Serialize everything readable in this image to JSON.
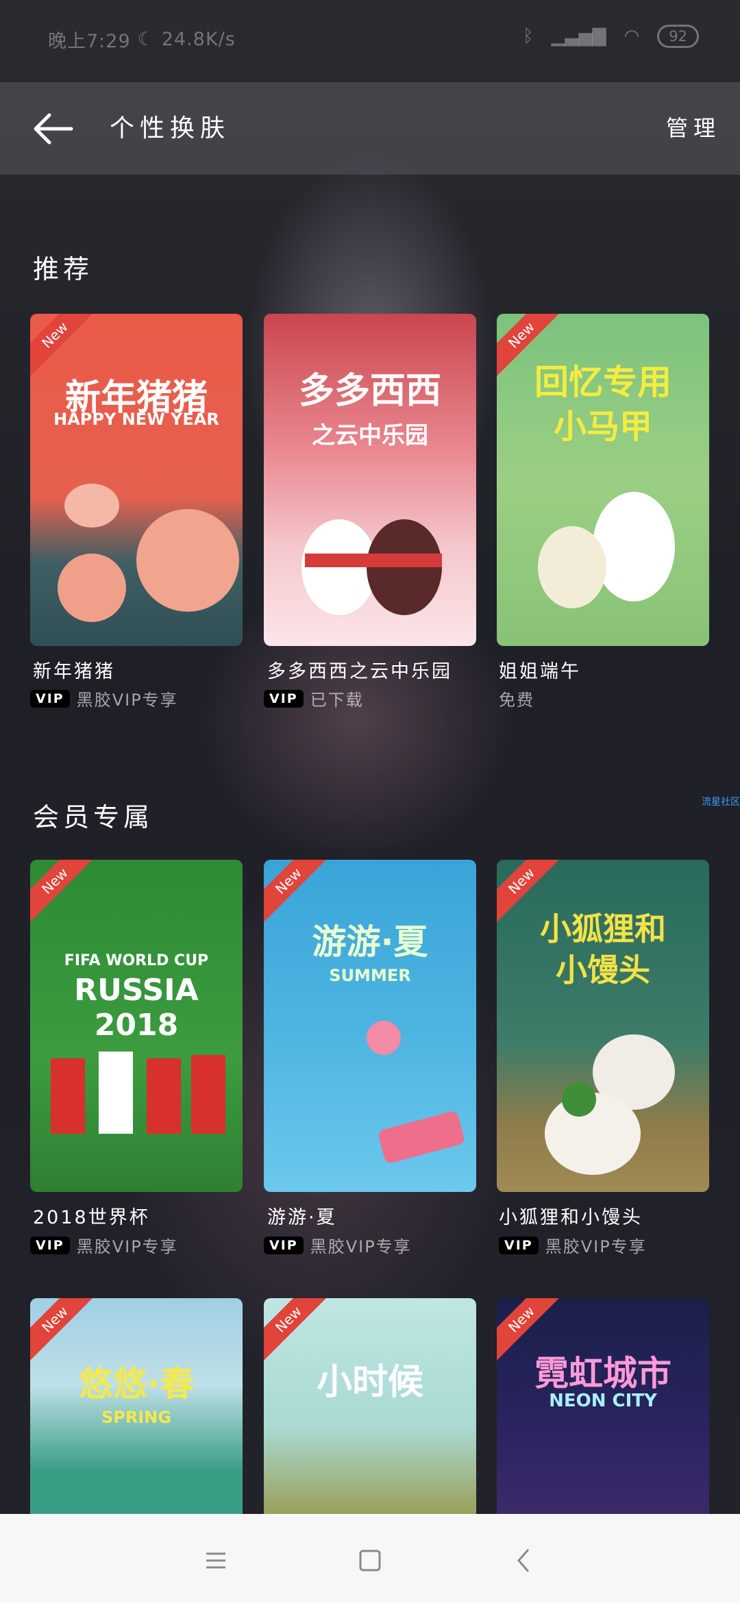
{
  "status_bar": {
    "time": "晚上7:29",
    "net_speed": "24.8K/s",
    "battery": "92"
  },
  "header": {
    "title": "个性换肤",
    "manage_label": "管理"
  },
  "sections": [
    {
      "title": "推荐"
    },
    {
      "title": "会员专属"
    }
  ],
  "recommended": [
    {
      "card_text": "新年猪猪",
      "card_sub": "HAPPY NEW YEAR",
      "name": "新年猪猪",
      "badge": "VIP",
      "status": "黑胶VIP专享",
      "ribbon": "New"
    },
    {
      "card_text": "多多西西",
      "card_sub": "之云中乐园",
      "name": "多多西西之云中乐园",
      "badge": "VIP",
      "status": "已下载",
      "ribbon": ""
    },
    {
      "card_text": "回忆专用",
      "card_sub": "小马甲",
      "name": "姐姐端午",
      "badge": "",
      "status": "免费",
      "ribbon": "New"
    }
  ],
  "vip": [
    {
      "card_text": "FIFA WORLD CUP",
      "card_sub": "RUSSIA 2018",
      "name": "2018世界杯",
      "badge": "VIP",
      "status": "黑胶VIP专享",
      "ribbon": "New"
    },
    {
      "card_text": "游游·夏",
      "card_sub": "SUMMER",
      "name": "游游·夏",
      "badge": "VIP",
      "status": "黑胶VIP专享",
      "ribbon": "New"
    },
    {
      "card_text": "小狐狸和",
      "card_sub": "小馒头",
      "name": "小狐狸和小馒头",
      "badge": "VIP",
      "status": "黑胶VIP专享",
      "ribbon": "New"
    }
  ],
  "more": [
    {
      "card_text": "悠悠·春",
      "card_sub": "SPRING",
      "ribbon": "New"
    },
    {
      "card_text": "小时候",
      "card_sub": "",
      "ribbon": "New"
    },
    {
      "card_text": "霓虹城市",
      "card_sub": "NEON CITY",
      "ribbon": "New"
    }
  ],
  "side_tag": "流星社区",
  "colors": {
    "ribbon": "#e0443a",
    "accent_link": "#3aa0ff"
  }
}
